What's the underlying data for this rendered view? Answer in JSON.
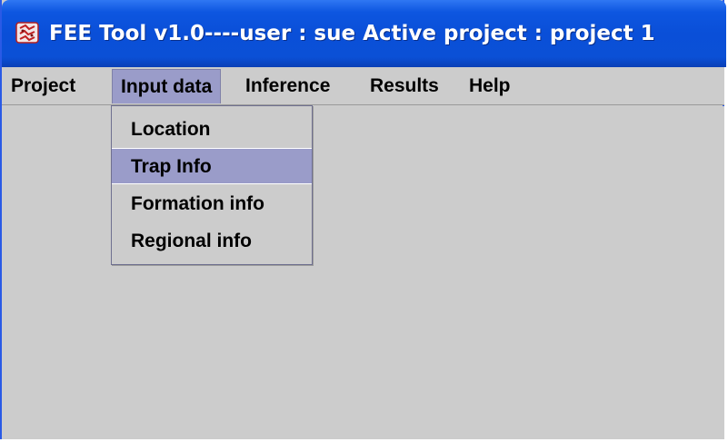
{
  "window": {
    "title": "FEE  Tool v1.0----user : sue Active project : project 1",
    "icon": "app-logo-icon"
  },
  "menubar": {
    "items": [
      {
        "label": "Project",
        "active": false
      },
      {
        "label": "Input data",
        "active": true
      },
      {
        "label": "Inference",
        "active": false
      },
      {
        "label": "Results",
        "active": false
      },
      {
        "label": "Help",
        "active": false
      }
    ]
  },
  "dropdown": {
    "items": [
      {
        "label": "Location",
        "highlighted": false
      },
      {
        "label": "Trap Info",
        "highlighted": true
      },
      {
        "label": "Formation info",
        "highlighted": false
      },
      {
        "label": "Regional info",
        "highlighted": false
      }
    ]
  },
  "colors": {
    "titlebar": "#0b50d6",
    "background": "#cccccc",
    "highlight": "#9a9cc9"
  }
}
